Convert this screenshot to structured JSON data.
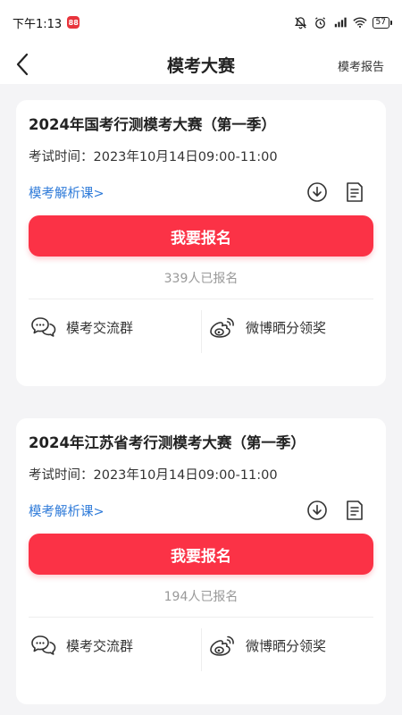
{
  "status_bar": {
    "time": "下午1:13",
    "badge": "88",
    "battery": "57"
  },
  "nav": {
    "title": "模考大赛",
    "report_link": "模考报告"
  },
  "cards": [
    {
      "title": "2024年国考行测模考大赛（第一季）",
      "exam_time": "考试时间：2023年10月14日09:00-11:00",
      "analysis_link": "模考解析课>",
      "signup_label": "我要报名",
      "signup_count": "339人已报名",
      "group_label": "模考交流群",
      "weibo_label": "微博晒分领奖"
    },
    {
      "title": "2024年江苏省考行测模考大赛（第一季）",
      "exam_time": "考试时间：2023年10月14日09:00-11:00",
      "analysis_link": "模考解析课>",
      "signup_label": "我要报名",
      "signup_count": "194人已报名",
      "group_label": "模考交流群",
      "weibo_label": "微博晒分领奖"
    }
  ],
  "colors": {
    "accent_red": "#fb3246",
    "link_blue": "#2f7bd9",
    "background": "#f4f4f6"
  }
}
